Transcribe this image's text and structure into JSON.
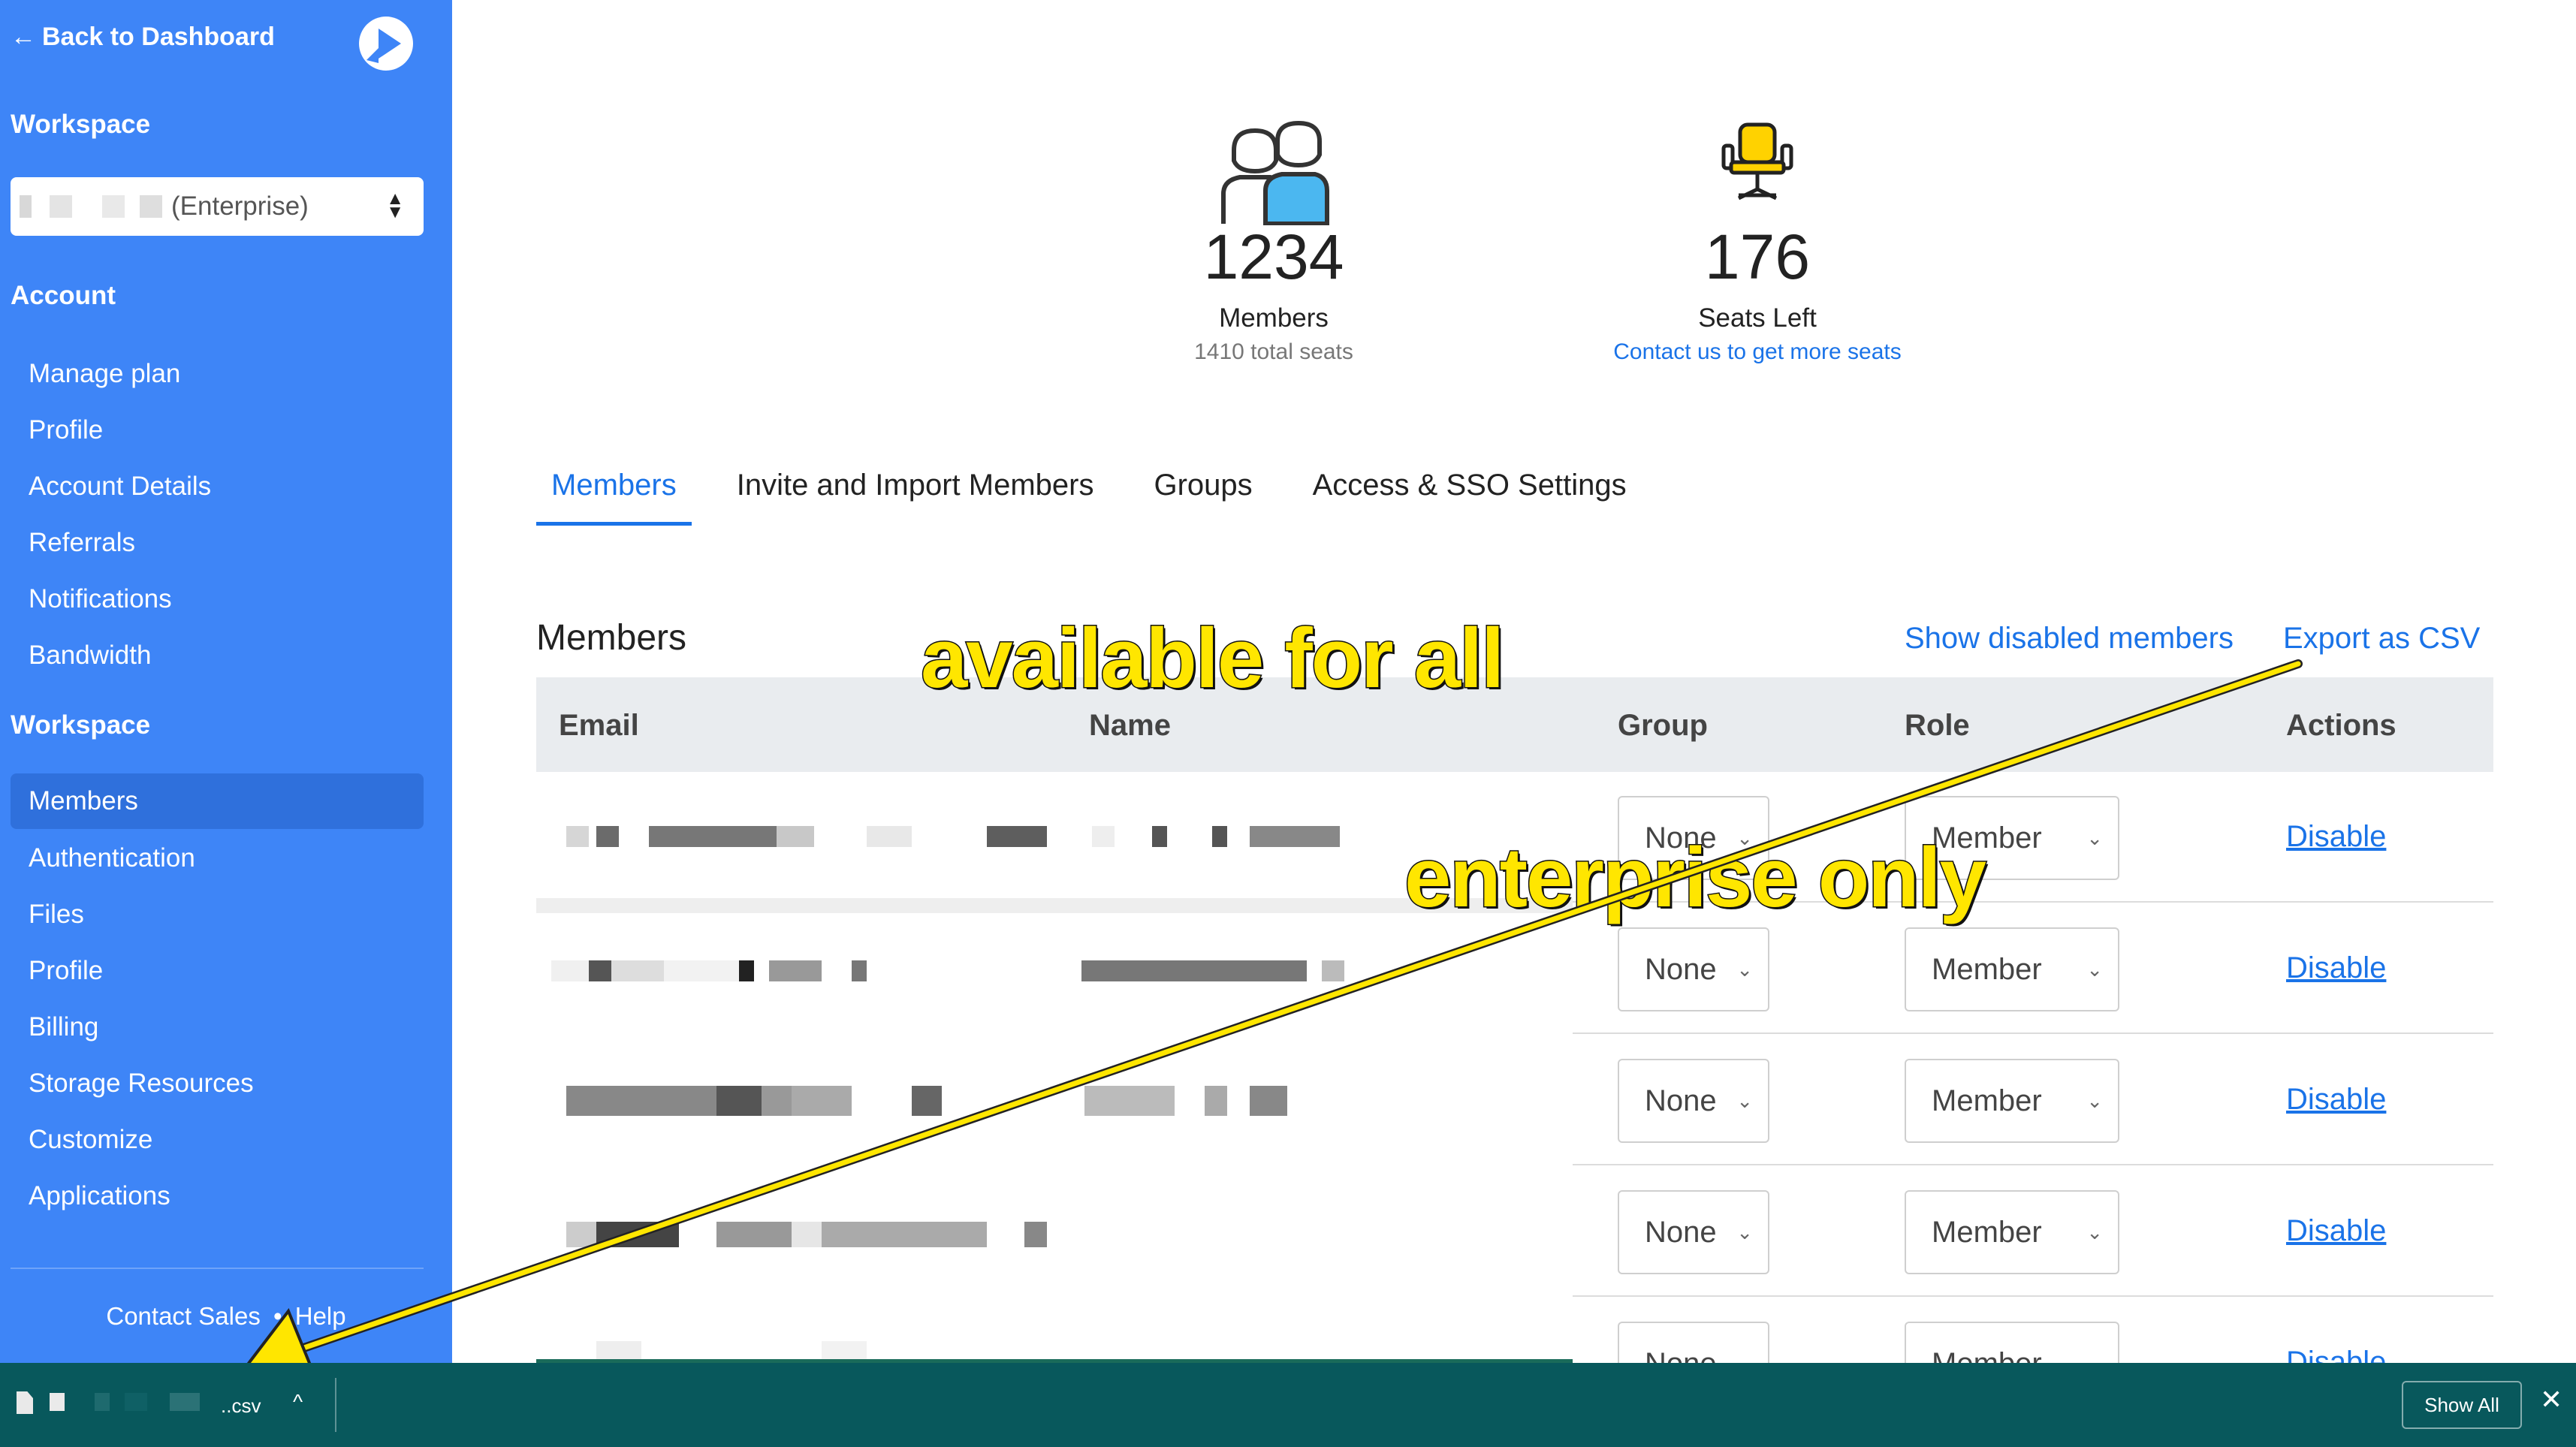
{
  "sidebar": {
    "back_label": "Back to Dashboard",
    "workspace_heading": "Workspace",
    "workspace_select_value": "(Enterprise)",
    "account_heading": "Account",
    "account_items": [
      "Manage plan",
      "Profile",
      "Account Details",
      "Referrals",
      "Notifications",
      "Bandwidth"
    ],
    "workspace_section_heading": "Workspace",
    "workspace_items": [
      "Members",
      "Authentication",
      "Files",
      "Profile",
      "Billing",
      "Storage Resources",
      "Customize",
      "Applications"
    ],
    "active_item": "Members",
    "footer": {
      "contact": "Contact Sales",
      "separator": "•",
      "help": "Help"
    },
    "colors": {
      "background": "#3e85f7",
      "active": "#2f70dc"
    }
  },
  "stats": {
    "members": {
      "number": "1234",
      "label": "Members",
      "sub": "1410 total seats",
      "icon": "members-icon"
    },
    "seats": {
      "number": "176",
      "label": "Seats Left",
      "link": "Contact us to get more seats",
      "icon": "chair-icon"
    }
  },
  "tabs": [
    "Members",
    "Invite and Import Members",
    "Groups",
    "Access & SSO Settings"
  ],
  "members": {
    "title": "Members",
    "show_disabled": "Show disabled members",
    "export": "Export as CSV",
    "columns": {
      "email": "Email",
      "name": "Name",
      "group": "Group",
      "role": "Role",
      "actions": "Actions"
    },
    "rows": [
      {
        "group": "None",
        "role": "Member",
        "action": "Disable"
      },
      {
        "group": "None",
        "role": "Member",
        "action": "Disable"
      },
      {
        "group": "None",
        "role": "Member",
        "action": "Disable"
      },
      {
        "group": "None",
        "role": "Member",
        "action": "Disable"
      },
      {
        "group": "None",
        "role": "Member",
        "action": "Disable"
      }
    ]
  },
  "download_bar": {
    "file_name": "..csv",
    "show_all": "Show All",
    "close": "✕",
    "color": "#08585c"
  },
  "annotations": {
    "available": "available for all",
    "enterprise": "enterprise only",
    "color": "#ffe600"
  }
}
